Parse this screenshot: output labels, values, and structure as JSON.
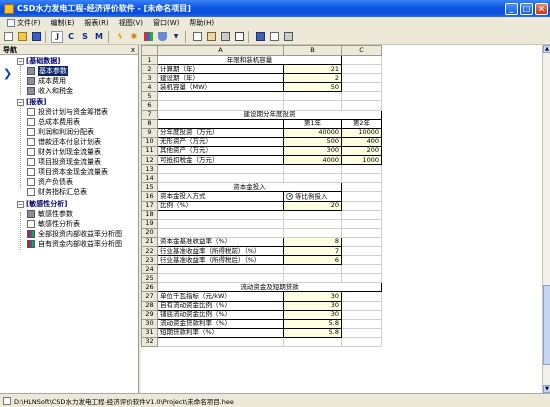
{
  "window": {
    "title": "CSD水力发电工程-经济评价软件 - [未命名项目]",
    "buttons": [
      "minimize",
      "maximize",
      "close"
    ]
  },
  "menu": [
    {
      "label": "文件(F)",
      "icon": "app-menu-icon"
    },
    {
      "label": "编制(E)"
    },
    {
      "label": "报表(R)"
    },
    {
      "label": "视图(V)"
    },
    {
      "label": "窗口(W)"
    },
    {
      "label": "帮助(H)"
    }
  ],
  "toolbar": {
    "letters": [
      "J",
      "C",
      "S",
      "M"
    ],
    "icons": [
      "new-icon",
      "open-icon",
      "save-icon",
      "lightning-icon",
      "star-icon",
      "chart-icon",
      "shield-icon",
      "dropdown-icon",
      "copy-icon",
      "paste-icon",
      "print-icon",
      "table-icon",
      "book-icon",
      "edit-icon",
      "print-icon"
    ]
  },
  "nav": {
    "header": "导航",
    "close": "x",
    "groups": [
      {
        "label": "[基础数据]",
        "items": [
          "基本参数",
          "成本费用",
          "收入和税金"
        ]
      },
      {
        "label": "[报表]",
        "items": [
          "投资计划与资金筹措表",
          "总成本费用表",
          "利润和利润分配表",
          "借款还本付息计划表",
          "财务计划现金流量表",
          "项目投资现金流量表",
          "项目资本金现金流量表",
          "资产负债表",
          "财务指标汇总表"
        ]
      },
      {
        "label": "[敏感性分析]",
        "items": [
          "敏感性参数",
          "敏感性分析表",
          "全部投资内部收益率分析图",
          "自有资金内部收益率分析图"
        ]
      }
    ]
  },
  "grid": {
    "columns": [
      "A",
      "B",
      "C"
    ],
    "rows": [
      {
        "n": "1",
        "a": "年限和装机容量",
        "b": "",
        "c": ""
      },
      {
        "n": "2",
        "a": "计算期（年）",
        "b": "21",
        "c": ""
      },
      {
        "n": "3",
        "a": "建设期（年）",
        "b": "2",
        "c": ""
      },
      {
        "n": "4",
        "a": "装机容量（MW）",
        "b": "50",
        "c": ""
      },
      {
        "n": "5",
        "a": "",
        "b": "",
        "c": ""
      },
      {
        "n": "6",
        "a": "",
        "b": "",
        "c": ""
      },
      {
        "n": "7",
        "a": "建设期分年度投资",
        "b": "",
        "c": ""
      },
      {
        "n": "8",
        "a": "",
        "b": "第1年",
        "c": "第2年"
      },
      {
        "n": "9",
        "a": "分年度投资（万元）",
        "b": "40000",
        "c": "10000"
      },
      {
        "n": "10",
        "a": "无形资产（万元）",
        "b": "500",
        "c": "400"
      },
      {
        "n": "11",
        "a": "其他资产（万元）",
        "b": "300",
        "c": "200"
      },
      {
        "n": "12",
        "a": "可抵扣税金（万元）",
        "b": "4000",
        "c": "1000"
      },
      {
        "n": "13",
        "a": "",
        "b": "",
        "c": ""
      },
      {
        "n": "14",
        "a": "",
        "b": "",
        "c": ""
      },
      {
        "n": "15",
        "a": "资本金投入",
        "b": "",
        "c": ""
      },
      {
        "n": "16",
        "a": "资本金投入方式",
        "b": "等比例投入",
        "c": ""
      },
      {
        "n": "17",
        "a": "比例（%）",
        "b": "20",
        "c": ""
      },
      {
        "n": "18",
        "a": "",
        "b": "",
        "c": ""
      },
      {
        "n": "19",
        "a": "",
        "b": "",
        "c": ""
      },
      {
        "n": "20",
        "a": "",
        "b": "",
        "c": ""
      },
      {
        "n": "21",
        "a": "资本金基准收益率（%）",
        "b": "8",
        "c": ""
      },
      {
        "n": "22",
        "a": "行业基准收益率（所得税前）（%）",
        "b": "7",
        "c": ""
      },
      {
        "n": "23",
        "a": "行业基准收益率（所得税后）（%）",
        "b": "6",
        "c": ""
      },
      {
        "n": "24",
        "a": "",
        "b": "",
        "c": ""
      },
      {
        "n": "25",
        "a": "",
        "b": "",
        "c": ""
      },
      {
        "n": "26",
        "a": "流动资金及短期贷款",
        "b": "",
        "c": ""
      },
      {
        "n": "27",
        "a": "单位千瓦指标（元/kW）",
        "b": "30",
        "c": ""
      },
      {
        "n": "28",
        "a": "自有流动资金比例（%）",
        "b": "30",
        "c": ""
      },
      {
        "n": "29",
        "a": "铺底流动资金比例（%）",
        "b": "30",
        "c": ""
      },
      {
        "n": "30",
        "a": "流动资金贷款利率（%）",
        "b": "5.8",
        "c": ""
      },
      {
        "n": "31",
        "a": "短期贷款利率（%）",
        "b": "5.8",
        "c": ""
      },
      {
        "n": "32",
        "a": "",
        "b": "",
        "c": ""
      }
    ]
  },
  "status": {
    "path": "D:\\HLNSoft\\CSD水力发电工程-经济评价软件V1.0\\Project\\未命名项目.hee"
  },
  "colors": {
    "titlebar": "#0b55e4",
    "input_cell": "#fefee0",
    "nav_group": "#00006e"
  }
}
